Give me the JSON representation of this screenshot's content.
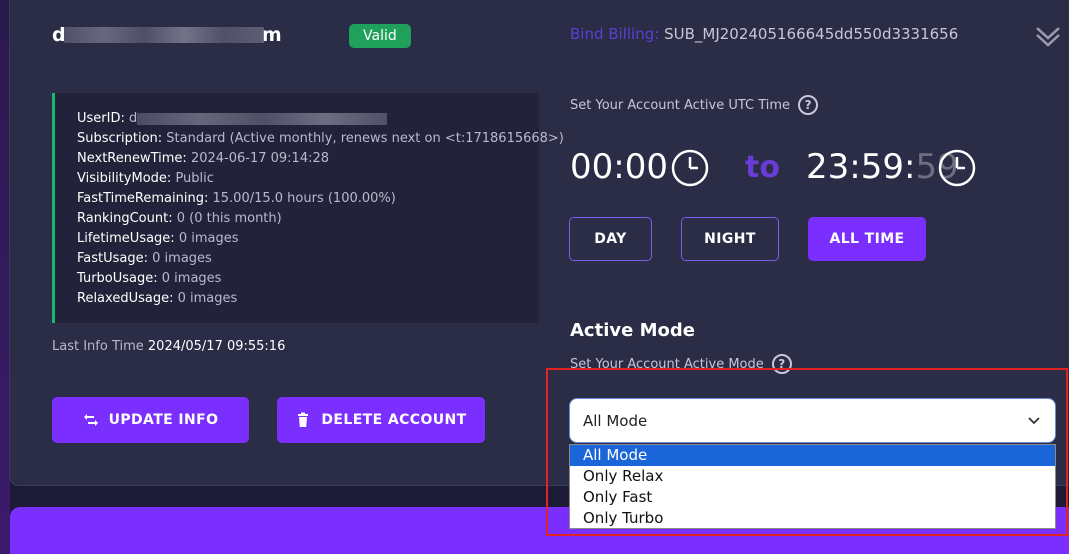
{
  "account": {
    "email_prefix": "d",
    "email_suffix": "m",
    "status_badge": "Valid"
  },
  "info": {
    "rows": [
      {
        "key": "UserID:",
        "value": "d"
      },
      {
        "key": "Subscription:",
        "value": "Standard (Active monthly, renews next on <t:1718615668>)"
      },
      {
        "key": "NextRenewTime:",
        "value": "2024-06-17 09:14:28"
      },
      {
        "key": "VisibilityMode:",
        "value": "Public"
      },
      {
        "key": "FastTimeRemaining:",
        "value": "15.00/15.0 hours (100.00%)"
      },
      {
        "key": "RankingCount:",
        "value": "0 (0 this month)"
      },
      {
        "key": "LifetimeUsage:",
        "value": "0 images"
      },
      {
        "key": "FastUsage:",
        "value": "0 images"
      },
      {
        "key": "TurboUsage:",
        "value": "0 images"
      },
      {
        "key": "RelaxedUsage:",
        "value": "0 images"
      }
    ],
    "last_info_label": "Last Info Time",
    "last_info_value": "2024/05/17 09:55:16"
  },
  "actions": {
    "update_label": "UPDATE INFO",
    "delete_label": "DELETE ACCOUNT"
  },
  "billing": {
    "label": "Bind Billing",
    "separator": ":",
    "value": "SUB_MJ202405166645dd550d3331656"
  },
  "utc": {
    "label": "Set Your Account Active UTC Time",
    "start_time": "00:00",
    "to_word": "to",
    "end_time_main": "23:59:",
    "end_time_seconds": "59",
    "presets": {
      "day": "DAY",
      "night": "NIGHT",
      "all_time": "ALL TIME"
    }
  },
  "mode": {
    "title": "Active Mode",
    "sub_label": "Set Your Account Active Mode",
    "selected": "All Mode",
    "options": [
      "All Mode",
      "Only Relax",
      "Only Fast",
      "Only Turbo"
    ]
  },
  "colors": {
    "accent": "#7b2fff",
    "valid_green": "#1fa15b",
    "highlight_red": "#e02424",
    "dropdown_selected": "#1a65d8"
  }
}
